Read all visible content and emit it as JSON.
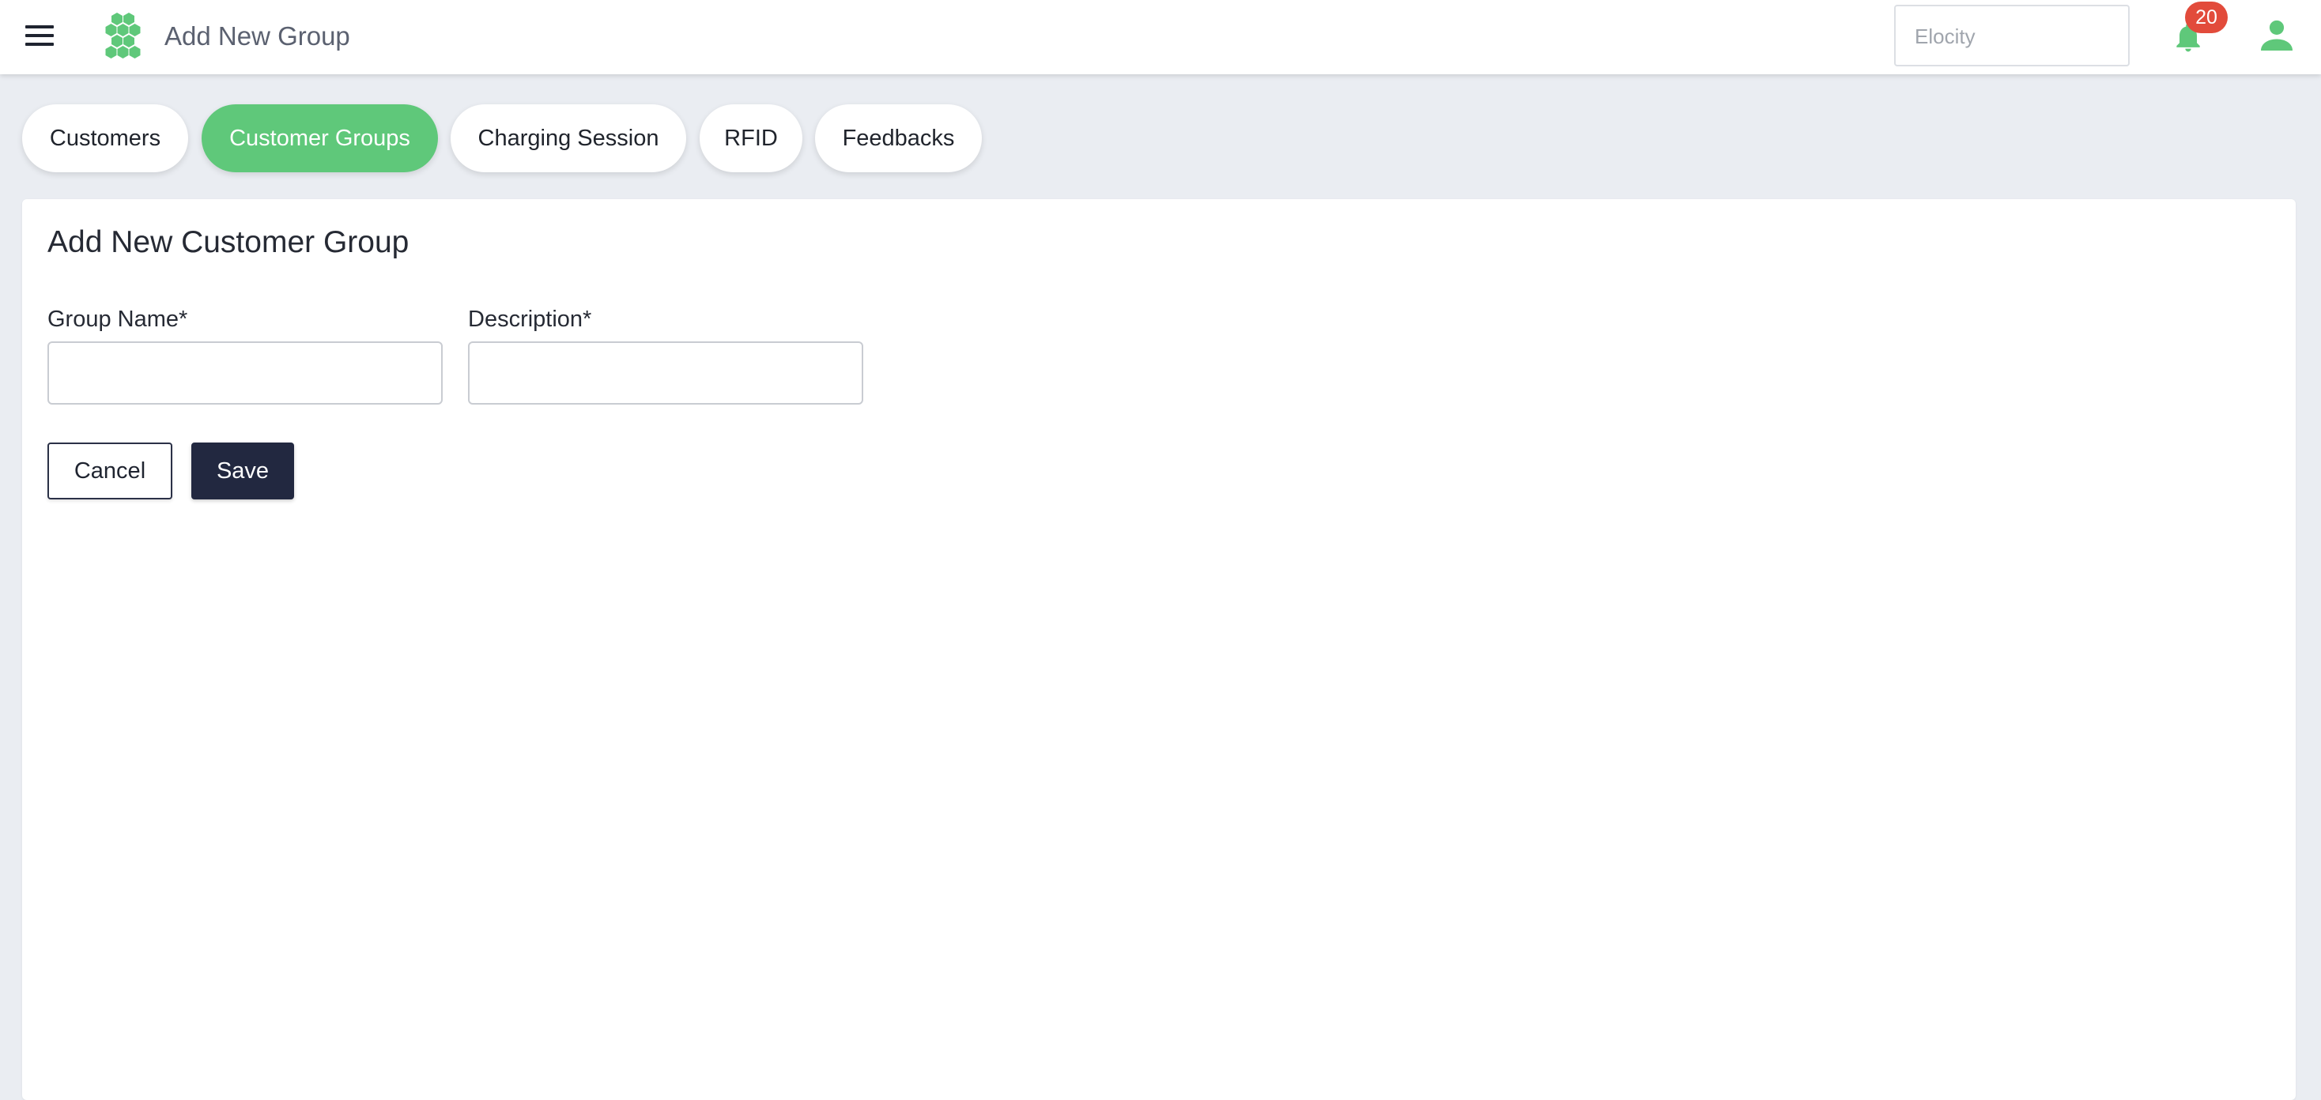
{
  "colors": {
    "brand_green": "#5fc87a",
    "primary_dark": "#222840",
    "badge_red": "#e24b3b",
    "background": "#eaedf2"
  },
  "header": {
    "menu_icon": "hamburger-menu-icon",
    "logo_icon": "hexagon-cluster-logo",
    "title": "Add New Group",
    "org_selector": {
      "value": "",
      "placeholder": "Elocity"
    },
    "notifications": {
      "icon": "bell-icon",
      "count": "20"
    },
    "user_icon": "user-icon"
  },
  "tabs": [
    {
      "label": "Customers",
      "active": false
    },
    {
      "label": "Customer Groups",
      "active": true
    },
    {
      "label": "Charging Session",
      "active": false
    },
    {
      "label": "RFID",
      "active": false
    },
    {
      "label": "Feedbacks",
      "active": false
    }
  ],
  "form": {
    "title": "Add New Customer Group",
    "fields": [
      {
        "label": "Group Name*",
        "value": "",
        "placeholder": ""
      },
      {
        "label": "Description*",
        "value": "",
        "placeholder": ""
      }
    ],
    "cancel_label": "Cancel",
    "save_label": "Save"
  }
}
